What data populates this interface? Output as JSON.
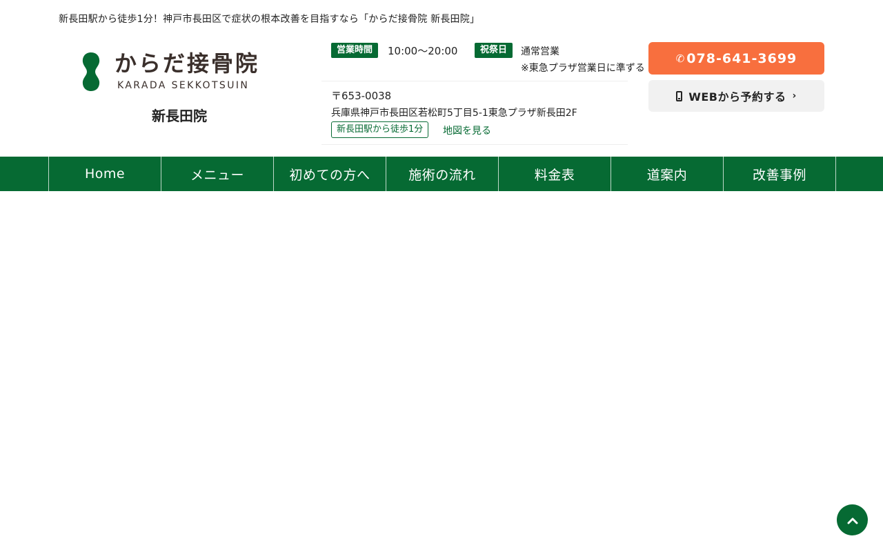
{
  "header": {
    "tagline": "新長田駅から徒歩1分！神戸市長田区で症状の根本改善を目指すなら「からだ接骨院 新長田院」",
    "logo": {
      "name_jp": "からだ接骨院",
      "name_en": "KARADA SEKKOTSUIN",
      "branch": "新長田院",
      "mark_color": "#066a33"
    },
    "hours": {
      "badge": "営業時間",
      "value": "10:00〜20:00"
    },
    "holiday": {
      "badge": "祝祭日",
      "value": "通常営業",
      "note": "※東急プラザ営業日に準ずる"
    },
    "address": {
      "zip": "〒653-0038",
      "line": "兵庫県神戸市長田区若松町5丁目5-1東急プラザ新長田2F",
      "walk_tag": "新長田駅から徒歩1分",
      "map_link": "地図を見る"
    },
    "cta": {
      "tel_icon": "phone-icon",
      "tel": "078-641-3699",
      "web_icon": "mobile-icon",
      "web_label": "WEBから予約する",
      "web_chevron": "›"
    }
  },
  "nav": {
    "items": [
      {
        "label": "Home"
      },
      {
        "label": "メニュー"
      },
      {
        "label": "初めての方へ"
      },
      {
        "label": "施術の流れ"
      },
      {
        "label": "料金表"
      },
      {
        "label": "道案内"
      },
      {
        "label": "改善事例"
      }
    ]
  },
  "page_top": {
    "icon": "chevron-up-icon"
  },
  "colors": {
    "brand_green": "#066a33",
    "tel_orange": "#f86f3e",
    "web_button_bg": "#f1f1f1"
  }
}
